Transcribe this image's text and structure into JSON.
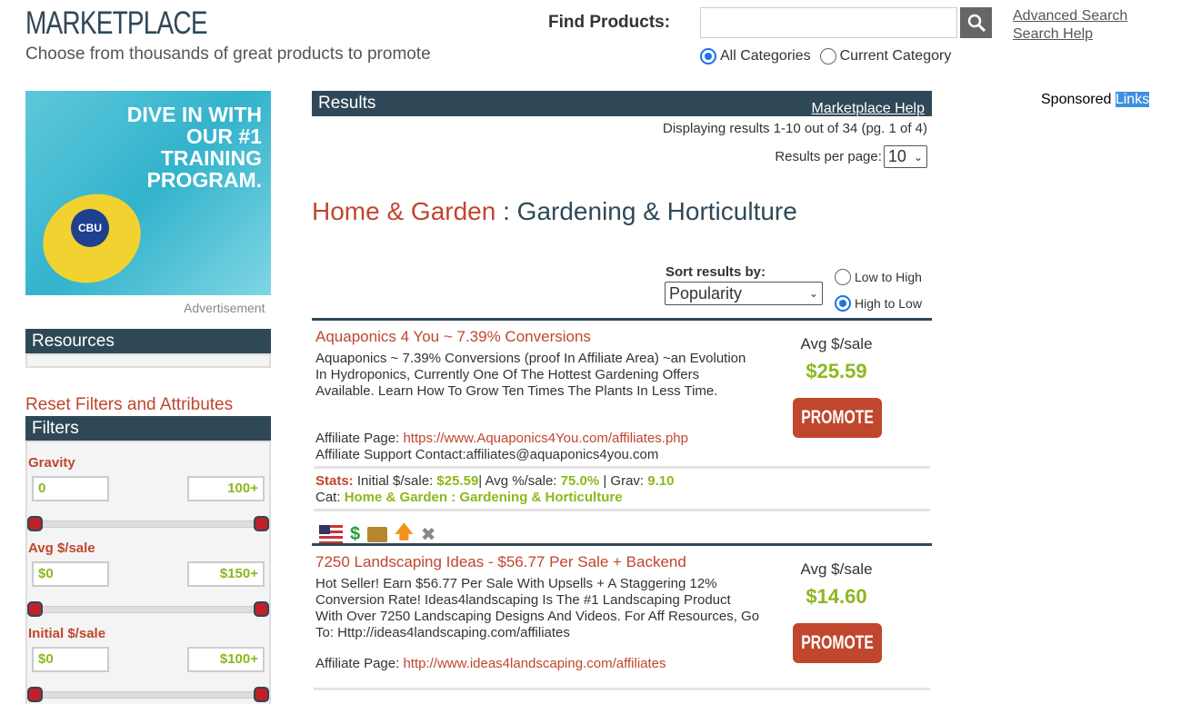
{
  "header": {
    "title": "MARKETPLACE",
    "tagline": "Choose from thousands of great products to promote",
    "find_label": "Find Products:",
    "search_value": "",
    "advanced_search": "Advanced Search",
    "search_help": "Search Help",
    "scope_all": "All Categories",
    "scope_current": "Current Category",
    "scope_selected": "All Categories"
  },
  "ad": {
    "text": "DIVE IN WITH OUR #1 TRAINING PROGRAM.",
    "badge": "CBU",
    "label": "Advertisement"
  },
  "sidebar": {
    "resources": "Resources",
    "reset": "Reset Filters and Attributes",
    "filters": "Filters",
    "groups": [
      {
        "label": "Gravity",
        "min": "0",
        "max": "100+"
      },
      {
        "label": "Avg $/sale",
        "min": "$0",
        "max": "$150+"
      },
      {
        "label": "Initial $/sale",
        "min": "$0",
        "max": "$100+"
      }
    ]
  },
  "results": {
    "title": "Results",
    "help": "Marketplace Help",
    "display": "Displaying results 1-10 out of 34 (pg. 1 of 4)",
    "per_page_label": "Results per page:",
    "per_page": "10"
  },
  "breadcrumb": {
    "parent": "Home & Garden",
    "sep": " : ",
    "child": "Gardening & Horticulture"
  },
  "sort": {
    "label": "Sort results by:",
    "value": "Popularity",
    "low": "Low to High",
    "high": "High to Low",
    "direction": "High to Low"
  },
  "sponsored": {
    "text": "Sponsored",
    "links": "Links"
  },
  "items": [
    {
      "title": "Aquaponics 4 You ~ 7.39% Conversions",
      "desc": "Aquaponics ~ 7.39% Conversions (proof In Affiliate Area) ~an Evolution In Hydroponics, Currently One Of The Hottest Gardening Offers Available. Learn How To Grow Ten Times The Plants In Less Time.",
      "aff_label": "Affiliate Page: ",
      "aff_url": "https://www.Aquaponics4You.com/affiliates.php",
      "support": "Affiliate Support Contact:affiliates@aquaponics4you.com",
      "avg_label": "Avg $/sale",
      "avg": "$25.59",
      "promote": "PROMOTE",
      "stats_label": "Stats:",
      "initial_label": " Initial $/sale: ",
      "initial": "$25.59",
      "avgpct_label": "| Avg %/sale: ",
      "avgpct": "75.0%",
      "grav_label": " | Grav: ",
      "grav": "9.10",
      "cat_label": "Cat: ",
      "cat": "Home & Garden : Gardening & Horticulture",
      "icons": [
        "us-flag-icon",
        "dollar-icon",
        "box-icon",
        "arrow-up-icon",
        "tools-icon"
      ]
    },
    {
      "title": "7250 Landscaping Ideas - $56.77 Per Sale + Backend",
      "desc": "Hot Seller! Earn $56.77 Per Sale With Upsells + A Staggering 12% Conversion Rate! Ideas4landscaping Is The #1 Landscaping Product With Over 7250 Landscaping Designs And Videos. For Aff Resources, Go To: Http://ideas4landscaping.com/affiliates",
      "aff_label": "Affiliate Page: ",
      "aff_url": "http://www.ideas4landscaping.com/affiliates",
      "avg_label": "Avg $/sale",
      "avg": "$14.60",
      "promote": "PROMOTE"
    }
  ]
}
